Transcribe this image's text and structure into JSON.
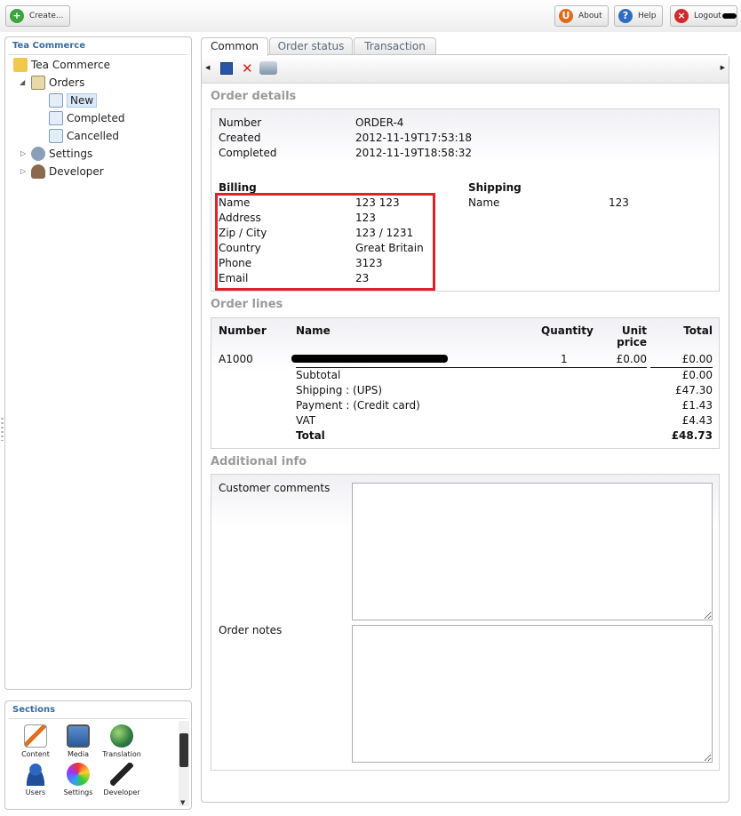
{
  "topbar": {
    "create_label": "Create...",
    "about_label": "About",
    "help_label": "Help",
    "logout_label": "Logout"
  },
  "sidebar": {
    "title": "Tea Commerce",
    "tree": {
      "root": "Tea Commerce",
      "orders": "Orders",
      "new": "New",
      "completed": "Completed",
      "cancelled": "Cancelled",
      "settings": "Settings",
      "developer": "Developer"
    }
  },
  "sections": {
    "title": "Sections",
    "items": [
      "Content",
      "Media",
      "Translation",
      "Users",
      "Settings",
      "Developer"
    ]
  },
  "tabs": [
    "Common",
    "Order status",
    "Transaction"
  ],
  "order_details": {
    "title": "Order details",
    "number_label": "Number",
    "number_value": "ORDER-4",
    "created_label": "Created",
    "created_value": "2012-11-19T17:53:18",
    "completed_label": "Completed",
    "completed_value": "2012-11-19T18:58:32",
    "billing": {
      "title": "Billing",
      "rows": [
        {
          "label": "Name",
          "value": "123 123"
        },
        {
          "label": "Address",
          "value": "123"
        },
        {
          "label": "Zip / City",
          "value": "123 / 1231"
        },
        {
          "label": "Country",
          "value": "Great Britain"
        },
        {
          "label": "Phone",
          "value": "3123"
        },
        {
          "label": "Email",
          "value": "23"
        }
      ]
    },
    "shipping": {
      "title": "Shipping",
      "name_label": "Name",
      "name_value": "123"
    }
  },
  "order_lines": {
    "title": "Order lines",
    "headers": {
      "number": "Number",
      "name": "Name",
      "quantity": "Quantity",
      "unit_price_1": "Unit",
      "unit_price_2": "price",
      "total": "Total"
    },
    "line": {
      "number": "A1000",
      "quantity": "1",
      "unit_price": "£0.00",
      "total": "£0.00"
    },
    "summary": [
      {
        "label": "Subtotal",
        "value": "£0.00"
      },
      {
        "label": "Shipping : (UPS)",
        "value": "£47.30"
      },
      {
        "label": "Payment : (Credit card)",
        "value": "£1.43"
      },
      {
        "label": "VAT",
        "value": "£4.43"
      },
      {
        "label": "Total",
        "value": "£48.73"
      }
    ]
  },
  "additional_info": {
    "title": "Additional info",
    "customer_comments_label": "Customer comments",
    "order_notes_label": "Order notes"
  },
  "colors": {
    "highlight_box": "#e0202a",
    "section_title": "#356ca0"
  }
}
